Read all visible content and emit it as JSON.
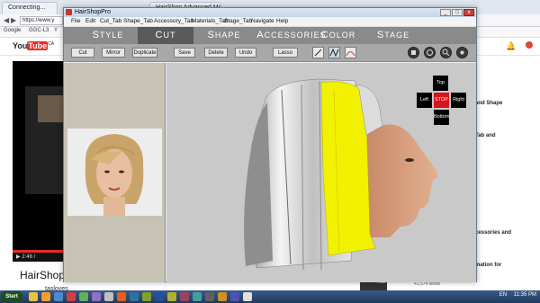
{
  "browser": {
    "tabs": [
      {
        "label": "Connecting..."
      },
      {
        "label": "HairShop Advanced Modeling"
      }
    ],
    "url": "https://www.y",
    "bookmarks": [
      "Google",
      "GGC-L3",
      "Y"
    ],
    "youtube_logo_you": "You",
    "youtube_logo_tube": "Tube",
    "youtube_region": "CA",
    "video_time": "2:46 /",
    "video_title": "HairShop ,",
    "channel_name": "tasloves",
    "sidebar_snippets": [
      "and Shape",
      "Tab and",
      "cessories and",
      "mation for"
    ],
    "related_duration": "7:33",
    "related_views": "41,574 views"
  },
  "taskbar": {
    "start_label": "Start",
    "language": "EN",
    "time": "11:35 PM"
  },
  "app": {
    "title": "HairShopPro",
    "window_min": "_",
    "window_max": "□",
    "window_close": "x",
    "menu": [
      "File",
      "Edit",
      "Cut_Tab",
      "Shape_Tab",
      "Accessory_Tab",
      "Materials_Tab",
      "Stage_Tab",
      "Navigate",
      "Help"
    ],
    "tabs": [
      {
        "label": "Style",
        "active": false
      },
      {
        "label": "Cut",
        "active": true
      },
      {
        "label": "Shape",
        "active": false
      },
      {
        "label": "Accessories",
        "active": false
      },
      {
        "label": "Color",
        "active": false
      },
      {
        "label": "Stage",
        "active": false
      }
    ],
    "toolbar": {
      "cut": "Cut",
      "mirror": "Mirror",
      "duplicate": "Duplicate",
      "save": "Save",
      "delete": "Delete",
      "undo": "Undo",
      "lasso": "Lasso"
    },
    "navigation": {
      "top": "Top",
      "left": "Left",
      "stop": "STOP",
      "right": "Right",
      "bottom": "Bottom"
    },
    "colors": {
      "tab_bar": "#8a8a8a",
      "active_tab": "#5a5a5a",
      "selected_hair": "#f2f200",
      "stop_button": "#d8141a"
    }
  }
}
